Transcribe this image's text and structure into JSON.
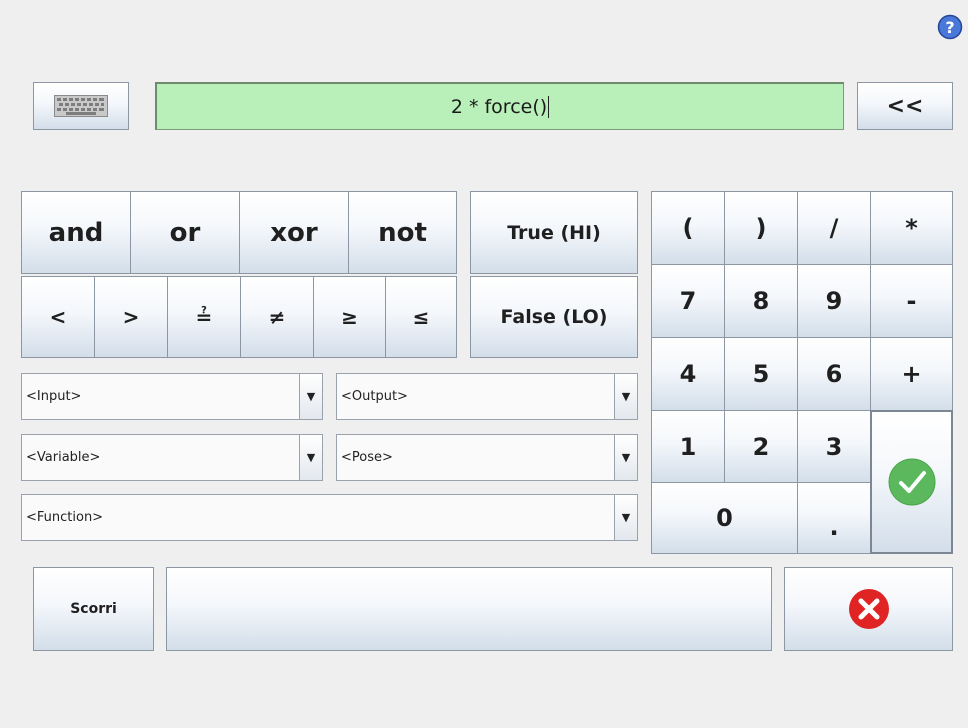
{
  "help": {
    "icon": "help-icon"
  },
  "top": {
    "keyboard_icon": "keyboard-icon",
    "expression": "2 * force()",
    "backspace": "<<"
  },
  "logic": [
    "and",
    "or",
    "xor",
    "not"
  ],
  "comparison": [
    "<",
    ">",
    "≟",
    "≠",
    "≥",
    "≤"
  ],
  "booleans": {
    "true_label": "True (HI)",
    "false_label": "False (LO)"
  },
  "dropdowns": {
    "input": "<Input>",
    "output": "<Output>",
    "variable": "<Variable>",
    "pose": "<Pose>",
    "function": "<Function>"
  },
  "keypad": {
    "row1": [
      "(",
      ")",
      "/",
      "*"
    ],
    "row2": [
      "7",
      "8",
      "9",
      "-"
    ],
    "row3": [
      "4",
      "5",
      "6",
      "+"
    ],
    "row4": [
      "1",
      "2",
      "3"
    ],
    "zero": "0",
    "dot": ".",
    "ok_icon": "checkmark-icon"
  },
  "bottom": {
    "scroll_label": "Scorri",
    "cancel_icon": "cancel-icon"
  },
  "colors": {
    "expression_bg": "#b9f0b9",
    "ok_green": "#5cb85c",
    "cancel_red": "#e02424",
    "help_blue": "#3a66c9"
  }
}
